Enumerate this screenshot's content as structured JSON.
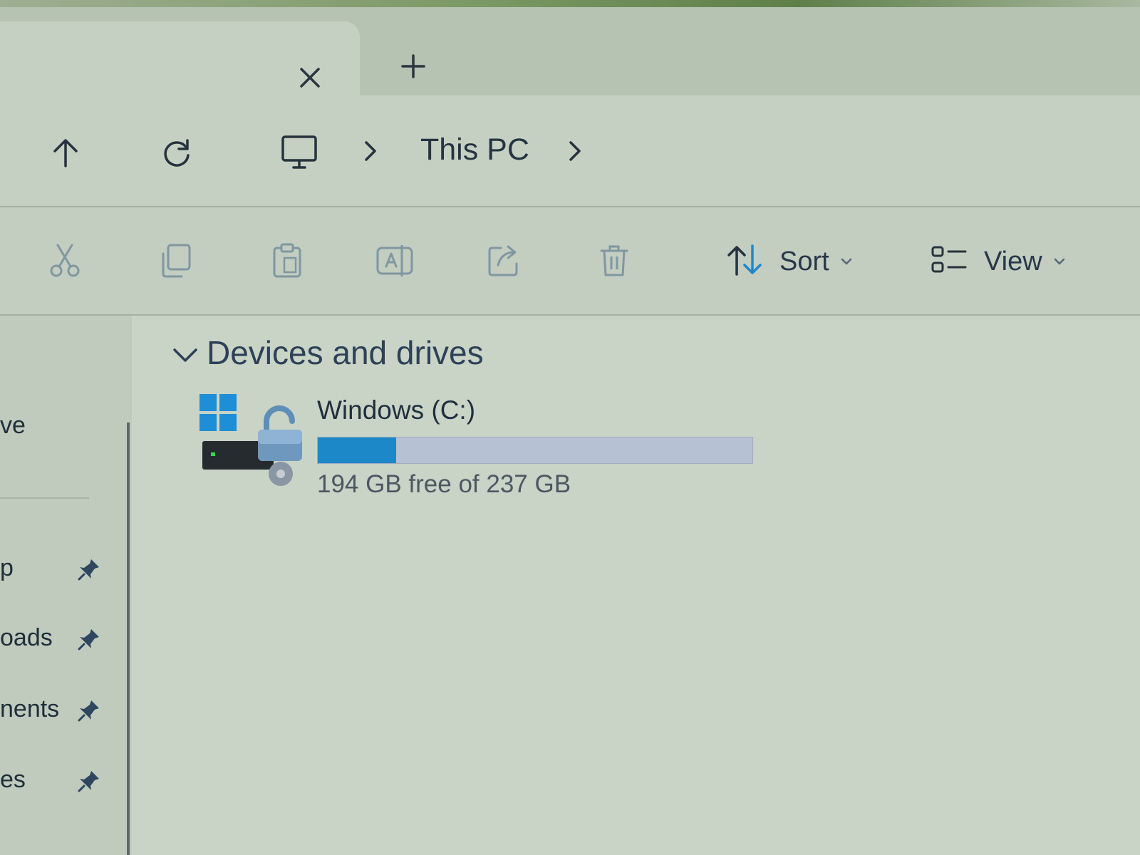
{
  "tabs": {
    "close_icon": "close-icon",
    "new_tab_icon": "plus-icon"
  },
  "nav": {
    "up_icon": "arrow-up-icon",
    "refresh_icon": "refresh-icon",
    "location_icon": "monitor-icon",
    "breadcrumb": {
      "current": "This PC"
    }
  },
  "command_bar": {
    "sort_label": "Sort",
    "view_label": "View",
    "disabled_icons": [
      "cut-icon",
      "copy-icon",
      "paste-icon",
      "rename-icon",
      "share-icon",
      "delete-icon"
    ]
  },
  "sidebar": {
    "items": [
      {
        "label": "ve",
        "pinned": false
      },
      {
        "label": "p",
        "pinned": true
      },
      {
        "label": "oads",
        "pinned": true
      },
      {
        "label": "nents",
        "pinned": true
      },
      {
        "label": "es",
        "pinned": true
      }
    ]
  },
  "main": {
    "section_title": "Devices and drives",
    "drives": [
      {
        "name": "Windows (C:)",
        "space_text": "194 GB free of 237 GB",
        "used_fraction": 0.18,
        "icon": "windows-drive-bitlocker-icon"
      }
    ]
  },
  "colors": {
    "accent": "#1d88c8",
    "bar_track": "#b7c1d4"
  }
}
